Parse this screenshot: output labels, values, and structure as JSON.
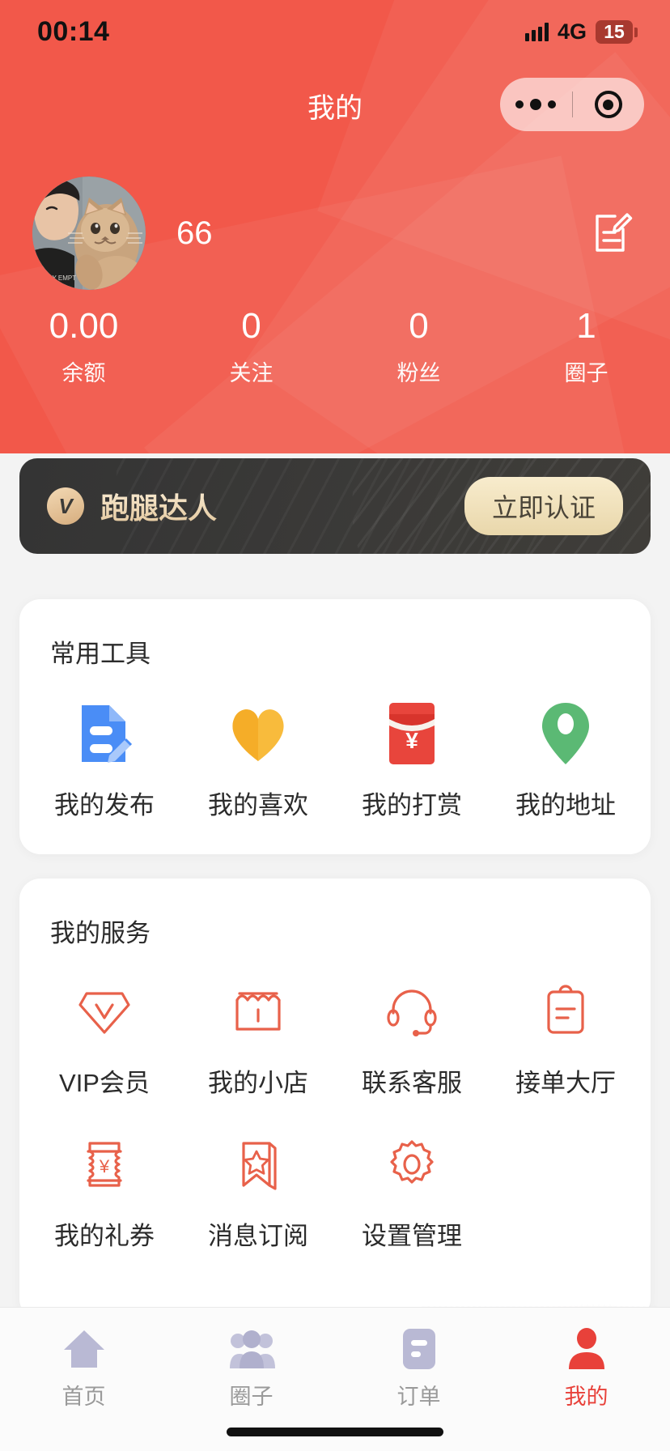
{
  "status_bar": {
    "time": "00:14",
    "network": "4G",
    "battery": "15",
    "signal_icon": "signal-bars-icon",
    "battery_icon": "battery-icon"
  },
  "nav": {
    "title": "我的",
    "capsule": {
      "more_icon": "more-dots-icon",
      "target_icon": "target-circle-icon"
    }
  },
  "profile": {
    "avatar_name": "avatar",
    "username": "66",
    "edit_icon": "edit-document-icon"
  },
  "stats": [
    {
      "value": "0.00",
      "label": "余额"
    },
    {
      "value": "0",
      "label": "关注"
    },
    {
      "value": "0",
      "label": "粉丝"
    },
    {
      "value": "1",
      "label": "圈子"
    }
  ],
  "banner": {
    "badge": "V",
    "title": "跑腿达人",
    "button": "立即认证"
  },
  "tools_card": {
    "title": "常用工具",
    "items": [
      {
        "label": "我的发布",
        "icon": "document-edit-icon",
        "color": "#4a8df6"
      },
      {
        "label": "我的喜欢",
        "icon": "heart-icon",
        "color": "#f8bb3c"
      },
      {
        "label": "我的打赏",
        "icon": "red-envelope-icon",
        "color": "#e8453c"
      },
      {
        "label": "我的地址",
        "icon": "location-pin-icon",
        "color": "#5bb974"
      }
    ]
  },
  "services_card": {
    "title": "我的服务",
    "items": [
      {
        "label": "VIP会员",
        "icon": "diamond-vip-icon"
      },
      {
        "label": "我的小店",
        "icon": "store-icon"
      },
      {
        "label": "联系客服",
        "icon": "headset-icon"
      },
      {
        "label": "接单大厅",
        "icon": "clipboard-icon"
      },
      {
        "label": "我的礼券",
        "icon": "coupon-yuan-icon"
      },
      {
        "label": "消息订阅",
        "icon": "bookmark-star-icon"
      },
      {
        "label": "设置管理",
        "icon": "gear-icon"
      }
    ]
  },
  "tabbar": {
    "items": [
      {
        "label": "首页",
        "icon": "home-icon",
        "active": false
      },
      {
        "label": "圈子",
        "icon": "people-icon",
        "active": false
      },
      {
        "label": "订单",
        "icon": "order-icon",
        "active": false
      },
      {
        "label": "我的",
        "icon": "person-icon",
        "active": true
      }
    ]
  },
  "colors": {
    "brand_red": "#f25041",
    "active_red": "#e8413a",
    "service_icon": "#e8614a",
    "banner_dark": "#3a3937",
    "banner_gold": "#ead7ab"
  }
}
